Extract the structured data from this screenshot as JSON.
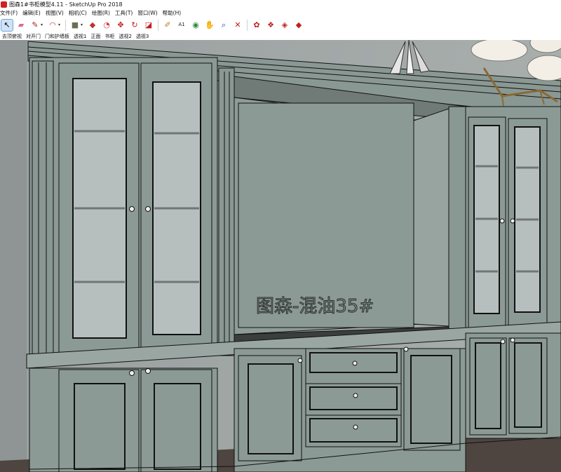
{
  "window": {
    "title": "图森1#书柜模型4.11 - SketchUp Pro 2018"
  },
  "menu": [
    "文件(F)",
    "编辑(E)",
    "视图(V)",
    "相机(C)",
    "绘图(R)",
    "工具(T)",
    "窗口(W)",
    "帮助(H)"
  ],
  "toolbar": {
    "tools": [
      {
        "name": "select-tool-icon",
        "glyph": "↖",
        "color": "#000000",
        "selected": true
      },
      {
        "name": "eraser-tool-icon",
        "glyph": "▰",
        "color": "#e06a8a"
      },
      {
        "name": "pencil-tool-icon",
        "glyph": "✎",
        "color": "#b02020"
      },
      {
        "name": "arc-tool-icon",
        "glyph": "◠",
        "color": "#c04040"
      },
      {
        "name": "shapes-tool-icon",
        "glyph": "■",
        "color": "#6d6d55"
      },
      {
        "name": "push-pull-tool-icon",
        "glyph": "◆",
        "color": "#c03030"
      },
      {
        "name": "offset-tool-icon",
        "glyph": "◔",
        "color": "#d04040"
      },
      {
        "name": "move-tool-icon",
        "glyph": "✥",
        "color": "#c02020"
      },
      {
        "name": "rotate-tool-icon",
        "glyph": "↻",
        "color": "#c02020"
      },
      {
        "name": "scale-tool-icon",
        "glyph": "◪",
        "color": "#c02020"
      },
      {
        "name": "tape-measure-tool-icon",
        "glyph": "✐",
        "color": "#b08020"
      },
      {
        "name": "text-tool-icon",
        "glyph": "A1",
        "color": "#222222"
      },
      {
        "name": "paint-bucket-tool-icon",
        "glyph": "◉",
        "color": "#2a8a3a"
      },
      {
        "name": "orbit-tool-icon",
        "glyph": "✋",
        "color": "#c0a060"
      },
      {
        "name": "zoom-tool-icon",
        "glyph": "⌕",
        "color": "#2040a0"
      },
      {
        "name": "zoom-extents-tool-icon",
        "glyph": "✕",
        "color": "#c02020"
      },
      {
        "name": "warehouse-icon",
        "glyph": "✿",
        "color": "#c02020"
      },
      {
        "name": "extension-warehouse-icon",
        "glyph": "❖",
        "color": "#c02020"
      },
      {
        "name": "send-to-layout-icon",
        "glyph": "◈",
        "color": "#c02020"
      },
      {
        "name": "extension-manager-icon",
        "glyph": "◆",
        "color": "#c02020"
      }
    ]
  },
  "scenes": [
    "去顶俯视",
    "对开门",
    "门和护墙板",
    "透视1",
    "正面",
    "书柜",
    "透视2",
    "透视3"
  ],
  "viewport": {
    "watermark": "图森-混油35#"
  },
  "colors": {
    "cabinet": "#8c9a95",
    "floor": "#4e4440",
    "wall": "#a1a7a6",
    "glass": "#b7bebe"
  }
}
